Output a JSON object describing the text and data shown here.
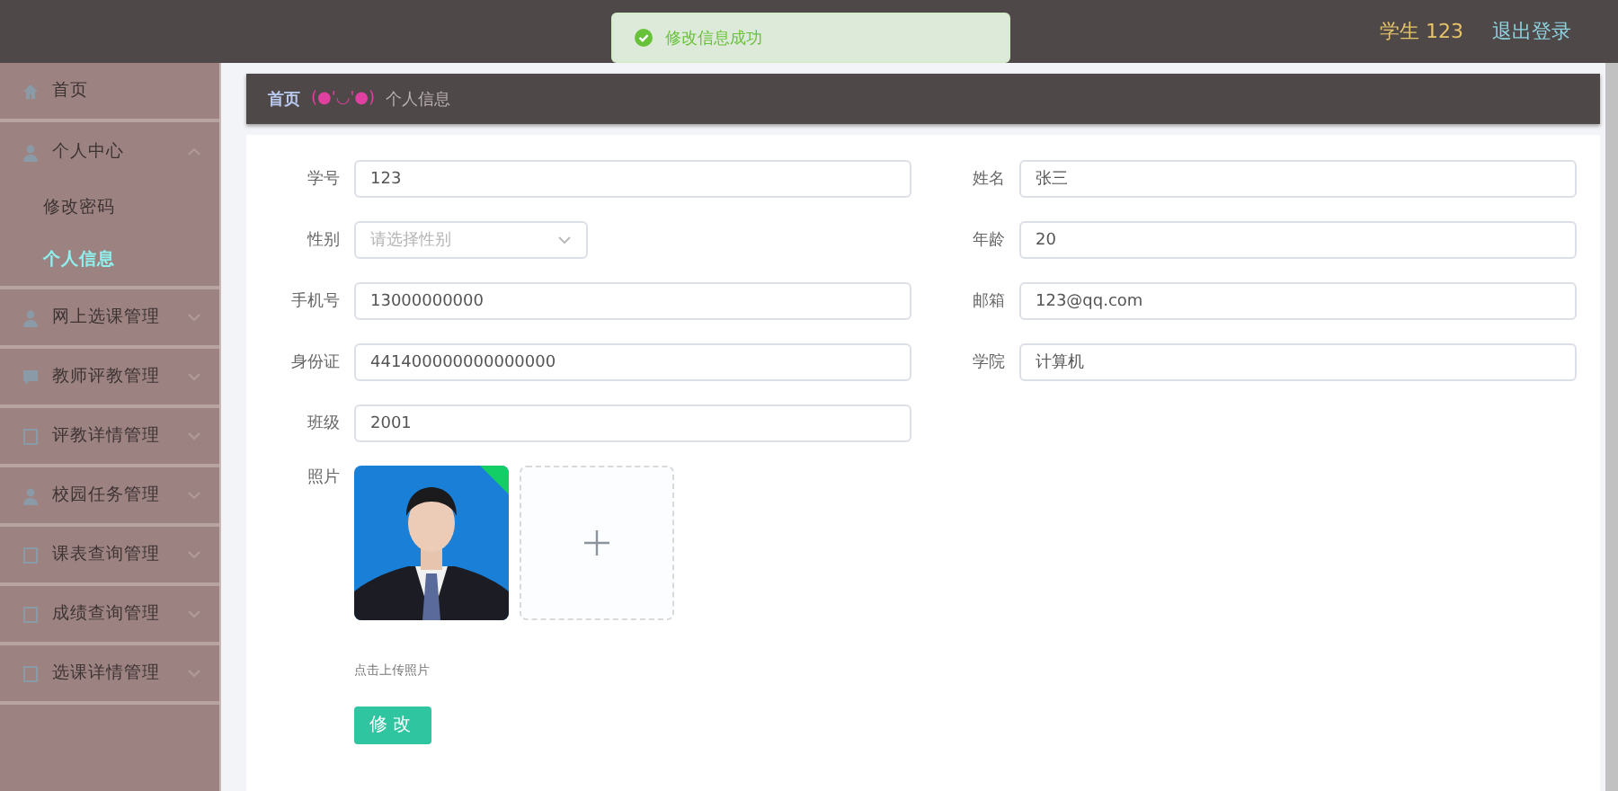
{
  "header": {
    "user": "学生 123",
    "logout": "退出登录"
  },
  "toast": {
    "kind": "success",
    "message": "修改信息成功"
  },
  "sidebar": {
    "items": [
      {
        "label": "首页"
      },
      {
        "label": "个人中心",
        "expanded": true,
        "children": [
          {
            "label": "修改密码",
            "selected": false
          },
          {
            "label": "个人信息",
            "selected": true
          }
        ]
      },
      {
        "label": "网上选课管理",
        "expanded": false
      },
      {
        "label": "教师评教管理",
        "expanded": false
      },
      {
        "label": "评教详情管理",
        "expanded": false
      },
      {
        "label": "校园任务管理",
        "expanded": false
      },
      {
        "label": "课表查询管理",
        "expanded": false
      },
      {
        "label": "成绩查询管理",
        "expanded": false
      },
      {
        "label": "选课详情管理",
        "expanded": false
      }
    ]
  },
  "breadcrumb": {
    "home": "首页",
    "emoticon": "(●'◡'●)",
    "current": "个人信息"
  },
  "form": {
    "rows": [
      [
        {
          "label": "学号",
          "kind": "input",
          "value": "123"
        },
        {
          "label": "姓名",
          "kind": "input",
          "value": "张三"
        }
      ],
      [
        {
          "label": "性别",
          "kind": "select",
          "placeholder": "请选择性别"
        },
        {
          "label": "年龄",
          "kind": "input",
          "value": "20"
        }
      ],
      [
        {
          "label": "手机号",
          "kind": "input",
          "value": "13000000000"
        },
        {
          "label": "邮箱",
          "kind": "input",
          "value": "123@qq.com"
        }
      ],
      [
        {
          "label": "身份证",
          "kind": "input",
          "value": "441400000000000000"
        },
        {
          "label": "学院",
          "kind": "input",
          "value": "计算机"
        }
      ],
      [
        {
          "label": "班级",
          "kind": "input",
          "value": "2001"
        }
      ]
    ],
    "photo": {
      "label": "照片",
      "uploaded": true,
      "hint": "点击上传照片"
    },
    "submit": "修改"
  }
}
